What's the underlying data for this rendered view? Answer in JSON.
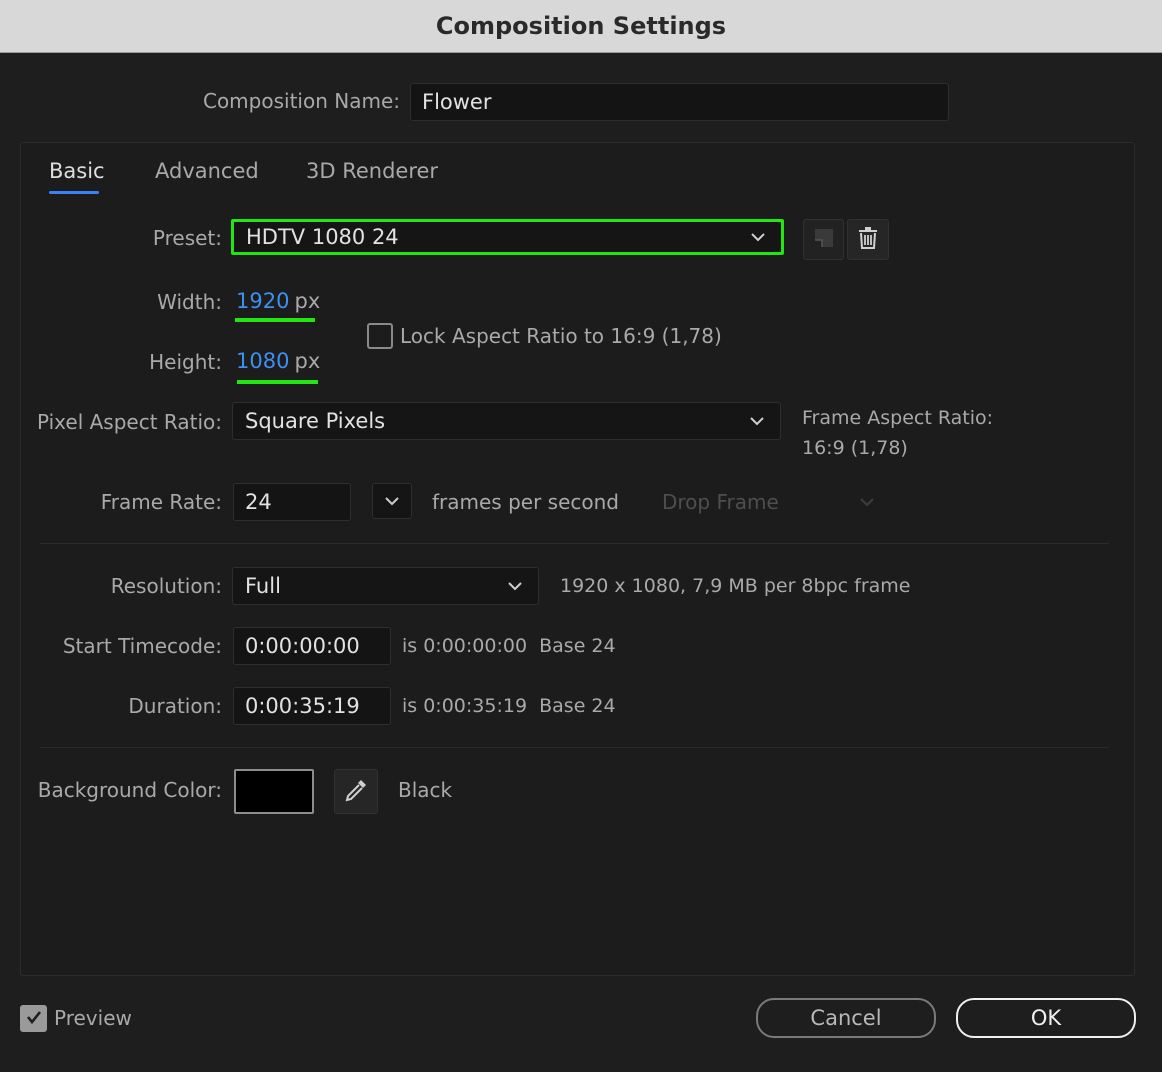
{
  "window": {
    "title": "Composition Settings"
  },
  "composition_name": {
    "label": "Composition Name:",
    "value": "Flower"
  },
  "tabs": [
    {
      "label": "Basic",
      "active": true
    },
    {
      "label": "Advanced",
      "active": false
    },
    {
      "label": "3D Renderer",
      "active": false
    }
  ],
  "preset": {
    "label": "Preset:",
    "value": "HDTV 1080 24"
  },
  "width": {
    "label": "Width:",
    "value": "1920",
    "unit": "px"
  },
  "height": {
    "label": "Height:",
    "value": "1080",
    "unit": "px"
  },
  "lock_aspect": {
    "label": "Lock Aspect Ratio to 16:9 (1,78)",
    "checked": false
  },
  "pixel_aspect": {
    "label": "Pixel Aspect Ratio:",
    "value": "Square Pixels"
  },
  "frame_aspect": {
    "label": "Frame Aspect Ratio:",
    "value": "16:9 (1,78)"
  },
  "frame_rate": {
    "label": "Frame Rate:",
    "value": "24",
    "units": "frames per second",
    "drop_frame": "Drop Frame"
  },
  "resolution": {
    "label": "Resolution:",
    "value": "Full",
    "info": "1920 x 1080, 7,9 MB per 8bpc frame"
  },
  "start_timecode": {
    "label": "Start Timecode:",
    "value": "0:00:00:00",
    "info": "is 0:00:00:00  Base 24"
  },
  "duration": {
    "label": "Duration:",
    "value": "0:00:35:19",
    "info": "is 0:00:35:19  Base 24"
  },
  "background": {
    "label": "Background Color:",
    "color": "#000000",
    "name": "Black"
  },
  "preview": {
    "label": "Preview",
    "checked": true
  },
  "buttons": {
    "cancel": "Cancel",
    "ok": "OK"
  },
  "colors": {
    "highlight": "#22e512",
    "accent_blue": "#3d8ff0"
  }
}
